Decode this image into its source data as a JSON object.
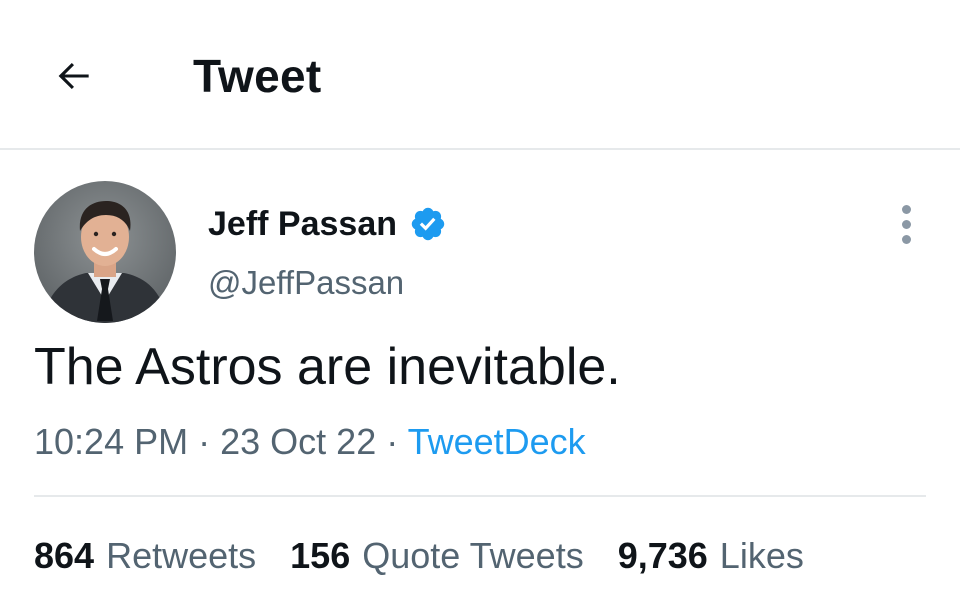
{
  "header": {
    "title": "Tweet",
    "back_icon": "arrow-left-icon"
  },
  "tweet": {
    "author": {
      "display_name": "Jeff Passan",
      "handle": "@JeffPassan",
      "verified": true,
      "verified_color": "#1d9bf0"
    },
    "text": "The Astros are inevitable.",
    "meta": {
      "time": "10:24 PM",
      "separator": "·",
      "date": "23 Oct 22",
      "source": "TweetDeck"
    },
    "stats": [
      {
        "count": "864",
        "label": "Retweets"
      },
      {
        "count": "156",
        "label": "Quote Tweets"
      },
      {
        "count": "9,736",
        "label": "Likes"
      }
    ]
  },
  "colors": {
    "text_primary": "#0f1419",
    "text_secondary": "#536471",
    "accent": "#1d9bf0",
    "divider": "#e6e9eb"
  }
}
